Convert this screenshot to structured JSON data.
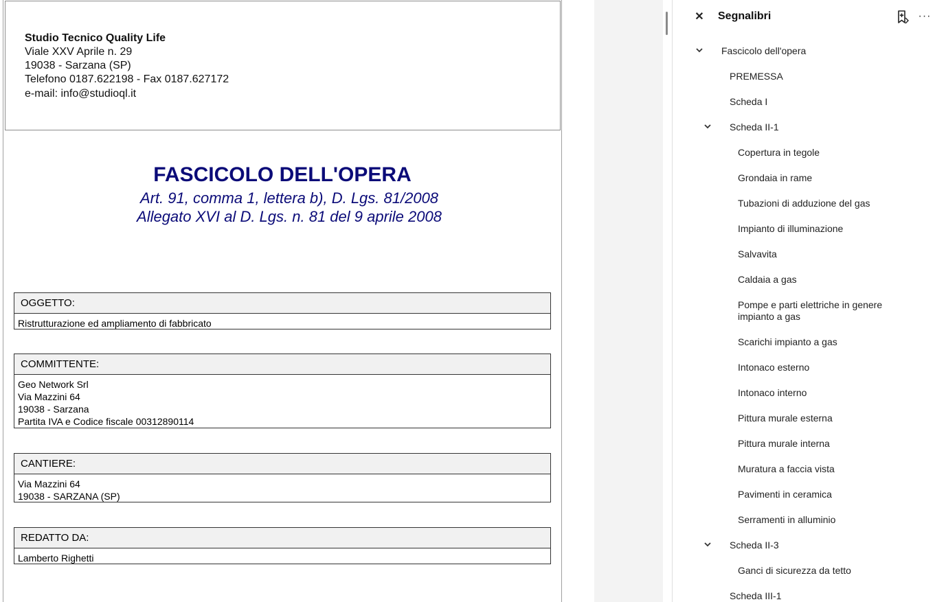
{
  "document": {
    "header": {
      "company": "Studio Tecnico Quality Life",
      "address": "Viale XXV Aprile n. 29",
      "city": "19038 - Sarzana (SP)",
      "phone": "Telefono 0187.622198 - Fax 0187.627172",
      "email": "e-mail: info@studioql.it"
    },
    "title": "FASCICOLO DELL'OPERA",
    "subtitle1": "Art. 91, comma 1, lettera b), D. Lgs. 81/2008",
    "subtitle2": "Allegato XVI al D. Lgs. n. 81 del 9 aprile 2008",
    "sections": [
      {
        "heading": "OGGETTO:",
        "lines": [
          "Ristrutturazione ed ampliamento di fabbricato"
        ]
      },
      {
        "heading": "COMMITTENTE:",
        "lines": [
          "Geo Network Srl",
          "Via Mazzini 64",
          "19038 - Sarzana",
          "Partita IVA e Codice fiscale 00312890114"
        ]
      },
      {
        "heading": "CANTIERE:",
        "lines": [
          "Via Mazzini 64",
          "19038 - SARZANA (SP)"
        ]
      },
      {
        "heading": "REDATTO DA:",
        "lines": [
          "Lamberto Righetti"
        ]
      }
    ]
  },
  "panel": {
    "close_icon": "close-icon",
    "title": "Segnalibri",
    "add_bookmark_icon": "bookmark-add-icon",
    "more_icon": "more-horizontal-icon",
    "bookmarks": [
      {
        "label": "Fascicolo dell'opera",
        "expanded": true
      },
      {
        "label": "PREMESSA"
      },
      {
        "label": "Scheda I"
      },
      {
        "label": "Scheda II-1",
        "expanded": true
      },
      {
        "label": "Copertura in tegole"
      },
      {
        "label": "Grondaia in rame"
      },
      {
        "label": "Tubazioni di adduzione del gas"
      },
      {
        "label": "Impianto di illuminazione"
      },
      {
        "label": "Salvavita"
      },
      {
        "label": "Caldaia a gas"
      },
      {
        "label": "Pompe e parti elettriche in genere",
        "label2": "impianto a gas"
      },
      {
        "label": "Scarichi impianto a gas"
      },
      {
        "label": "Intonaco esterno"
      },
      {
        "label": "Intonaco interno"
      },
      {
        "label": "Pittura murale esterna"
      },
      {
        "label": "Pittura murale interna"
      },
      {
        "label": "Muratura a faccia vista"
      },
      {
        "label": "Pavimenti in ceramica"
      },
      {
        "label": "Serramenti in alluminio"
      },
      {
        "label": "Scheda II-3",
        "expanded": true
      },
      {
        "label": "Ganci di sicurezza da tetto"
      },
      {
        "label": "Scheda III-1"
      }
    ]
  }
}
